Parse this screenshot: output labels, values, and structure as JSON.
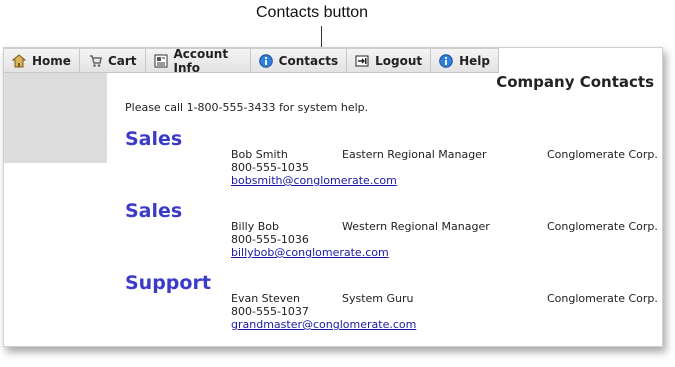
{
  "annotation": {
    "text": "Contacts button"
  },
  "nav": [
    {
      "label": "Home",
      "icon": "home-icon"
    },
    {
      "label": "Cart",
      "icon": "cart-icon"
    },
    {
      "label": "Account Info",
      "icon": "account-icon"
    },
    {
      "label": "Contacts",
      "icon": "info-icon"
    },
    {
      "label": "Logout",
      "icon": "logout-icon"
    },
    {
      "label": "Help",
      "icon": "help-icon"
    }
  ],
  "page": {
    "title": "Company Contacts",
    "help_text": "Please call 1-800-555-3433 for system help."
  },
  "sections": [
    {
      "heading": "Sales",
      "name": "Bob Smith",
      "role": "Eastern Regional Manager",
      "company": "Conglomerate Corp.",
      "phone": "800-555-1035",
      "email": "bobsmith@conglomerate.com"
    },
    {
      "heading": "Sales",
      "name": "Billy Bob",
      "role": "Western Regional Manager",
      "company": "Conglomerate Corp.",
      "phone": "800-555-1036",
      "email": "billybob@conglomerate.com"
    },
    {
      "heading": "Support",
      "name": "Evan Steven",
      "role": "System Guru",
      "company": "Conglomerate Corp.",
      "phone": "800-555-1037",
      "email": "grandmaster@conglomerate.com"
    }
  ]
}
